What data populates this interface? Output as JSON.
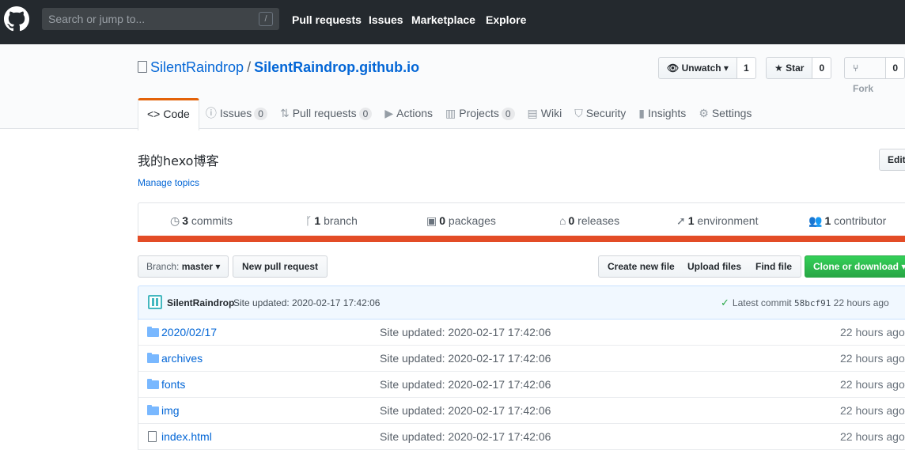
{
  "topbar": {
    "search_placeholder": "Search or jump to...",
    "search_shortcut": "/",
    "nav": [
      "Pull requests",
      "Issues",
      "Marketplace",
      "Explore"
    ]
  },
  "repo": {
    "owner": "SilentRaindrop",
    "separator": "/",
    "name": "SilentRaindrop.github.io",
    "watch_label": "Unwatch",
    "watch_count": "1",
    "star_label": "Star",
    "star_count": "0",
    "fork_label": "Fork",
    "fork_count": "0"
  },
  "tabs": [
    {
      "label": "Code",
      "icon": "code-icon",
      "counter": ""
    },
    {
      "label": "Issues",
      "icon": "issue-icon",
      "counter": "0"
    },
    {
      "label": "Pull requests",
      "icon": "pr-icon",
      "counter": "0"
    },
    {
      "label": "Actions",
      "icon": "play-icon",
      "counter": ""
    },
    {
      "label": "Projects",
      "icon": "project-icon",
      "counter": "0"
    },
    {
      "label": "Wiki",
      "icon": "book-icon",
      "counter": ""
    },
    {
      "label": "Security",
      "icon": "shield-icon",
      "counter": ""
    },
    {
      "label": "Insights",
      "icon": "graph-icon",
      "counter": ""
    },
    {
      "label": "Settings",
      "icon": "gear-icon",
      "counter": ""
    }
  ],
  "about": {
    "description": "我的hexo博客",
    "manage_topics": "Manage topics",
    "edit_label": "Edit"
  },
  "summary": [
    {
      "count": "3",
      "label": "commits",
      "icon": "history-icon"
    },
    {
      "count": "1",
      "label": "branch",
      "icon": "branch-icon"
    },
    {
      "count": "0",
      "label": "packages",
      "icon": "package-icon"
    },
    {
      "count": "0",
      "label": "releases",
      "icon": "tag-icon"
    },
    {
      "count": "1",
      "label": "environment",
      "icon": "rocket-icon"
    },
    {
      "count": "1",
      "label": "contributor",
      "icon": "people-icon"
    }
  ],
  "language_color": "#e34c26",
  "toolbar": {
    "branch_prefix": "Branch:",
    "branch_name": "master",
    "new_pr": "New pull request",
    "create_file": "Create new file",
    "upload_files": "Upload files",
    "find_file": "Find file",
    "clone": "Clone or download"
  },
  "commit": {
    "author": "SilentRaindrop",
    "message": "Site updated: 2020-02-17 17:42:06",
    "latest_label": "Latest commit",
    "sha": "58bcf91",
    "age": "22 hours ago"
  },
  "files": [
    {
      "name": "2020/02/17",
      "type": "dir",
      "message": "Site updated: 2020-02-17 17:42:06",
      "age": "22 hours ago"
    },
    {
      "name": "archives",
      "type": "dir",
      "message": "Site updated: 2020-02-17 17:42:06",
      "age": "22 hours ago"
    },
    {
      "name": "fonts",
      "type": "dir",
      "message": "Site updated: 2020-02-17 17:42:06",
      "age": "22 hours ago"
    },
    {
      "name": "img",
      "type": "dir",
      "message": "Site updated: 2020-02-17 17:42:06",
      "age": "22 hours ago"
    },
    {
      "name": "index.html",
      "type": "file",
      "message": "Site updated: 2020-02-17 17:42:06",
      "age": "22 hours ago"
    }
  ]
}
